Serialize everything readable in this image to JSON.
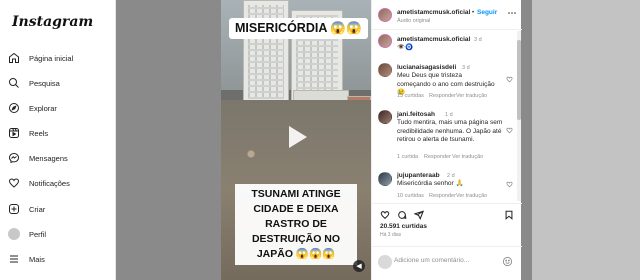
{
  "app": {
    "logo": "Instagram"
  },
  "nav": {
    "items": [
      {
        "label": "Página inicial",
        "icon": "home-icon"
      },
      {
        "label": "Pesquisa",
        "icon": "search-icon"
      },
      {
        "label": "Explorar",
        "icon": "compass-icon"
      },
      {
        "label": "Reels",
        "icon": "reels-icon"
      },
      {
        "label": "Mensagens",
        "icon": "messenger-icon"
      },
      {
        "label": "Notificações",
        "icon": "heart-icon"
      },
      {
        "label": "Criar",
        "icon": "plus-square-icon"
      },
      {
        "label": "Perfil",
        "icon": "avatar"
      },
      {
        "label": "Mais",
        "icon": "menu-icon"
      }
    ]
  },
  "post": {
    "media": {
      "caption_top": "MISERICÓRDIA 😱😱",
      "caption_bottom": "TSUNAMI ATINGE CIDADE E DEIXA RASTRO DE DESTRUIÇÃO NO JAPÃO 😱😱😱"
    },
    "header": {
      "username": "ametistamcmusk.oficial",
      "separator": "•",
      "follow_label": "Seguir",
      "audio": "Áudio original"
    },
    "caption": {
      "username": "ametistamcmusk.oficial",
      "time": "3 d",
      "emojis": "👁️🧿"
    },
    "comments": [
      {
        "username": "lucianaisagasisdeli",
        "time": "3 d",
        "text": "Meu Deus que tristeza começando o ano com destruição 😢",
        "likes": "13 curtidas",
        "reply": "Responder",
        "translate": "Ver tradução"
      },
      {
        "username": "jani.feitosah",
        "time": "1 d",
        "text": "Tudo mentira, mais uma página sem credibilidade nenhuma. O Japão até retirou o alerta de tsunami.",
        "likes": "1 curtida",
        "reply": "Responder",
        "translate": "Ver tradução"
      },
      {
        "username": "jujupanteraab",
        "time": "2 d",
        "text": "Misericórdia senhor 🙏",
        "likes": "10 curtidas",
        "reply": "Responder",
        "translate": "Ver tradução"
      }
    ],
    "likes_count": "20.591 curtidas",
    "time_ago": "Há 3 dias",
    "add_comment_placeholder": "Adicione um comentário..."
  }
}
